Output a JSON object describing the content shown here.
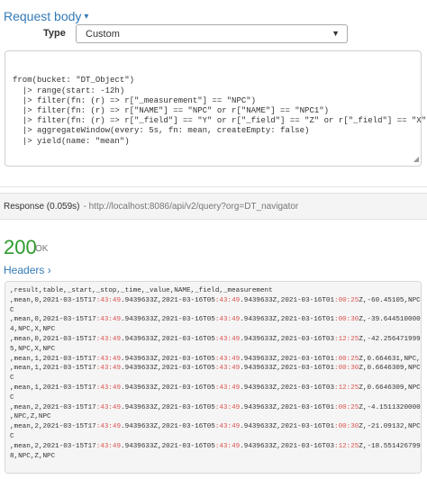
{
  "request": {
    "title": "Request body",
    "type_label": "Type",
    "type_value": "Custom",
    "query_lines": [
      "from(bucket: \"DT_Object\")",
      "  |> range(start: -12h)",
      "  |> filter(fn: (r) => r[\"_measurement\"] == \"NPC\")",
      "  |> filter(fn: (r) => r[\"NAME\"] == \"NPC\" or r[\"NAME\"] == \"NPC1\")",
      "  |> filter(fn: (r) => r[\"_field\"] == \"Y\" or r[\"_field\"] == \"Z\" or r[\"_field\"] == \"X\")",
      "  |> aggregateWindow(every: 5s, fn: mean, createEmpty: false)",
      "  |> yield(name: \"mean\")"
    ]
  },
  "response": {
    "label": "Response (0.059s)",
    "url": "- http://localhost:8086/api/v2/query?org=DT_navigator",
    "status_code": "200",
    "status_text": "OK",
    "headers_link": "Headers ›"
  },
  "csv_lines": [
    ",result,table,_start,_stop,_time,_value,NAME,_field,_measurement",
    ",mean,0,2021-03-15T17:43:49.9439633Z,2021-03-16T05:43:49.9439633Z,2021-03-16T01:00:25Z,-60.45105,NPC,X,NPC",
    "C",
    ",mean,0,2021-03-15T17:43:49.9439633Z,2021-03-16T05:43:49.9439633Z,2021-03-16T01:00:30Z,-39.6445100000000",
    "4,NPC,X,NPC",
    ",mean,0,2021-03-15T17:43:49.9439633Z,2021-03-16T05:43:49.9439633Z,2021-03-16T03:12:25Z,-42.2564719999999",
    "5,NPC,X,NPC",
    ",mean,1,2021-03-15T17:43:49.9439633Z,2021-03-16T05:43:49.9439633Z,2021-03-16T01:00:25Z,0.664631,NPC,Y,NPC",
    ",mean,1,2021-03-15T17:43:49.9439633Z,2021-03-16T05:43:49.9439633Z,2021-03-16T01:00:30Z,0.6646309,NPC,Y,NP",
    "C",
    ",mean,1,2021-03-15T17:43:49.9439633Z,2021-03-16T05:43:49.9439633Z,2021-03-16T03:12:25Z,0.6646309,NPC,Y,NP",
    "C",
    ",mean,2,2021-03-15T17:43:49.9439633Z,2021-03-16T05:43:49.9439633Z,2021-03-16T01:00:25Z,-4.151132000000006",
    ",NPC,Z,NPC",
    ",mean,2,2021-03-15T17:43:49.9439633Z,2021-03-16T05:43:49.9439633Z,2021-03-16T01:00:30Z,-21.09132,NPC,Z,NP",
    "C",
    ",mean,2,2021-03-15T17:43:49.9439633Z,2021-03-16T05:43:49.9439633Z,2021-03-16T03:12:25Z,-18.5514267999999",
    "8,NPC,Z,NPC"
  ],
  "colors": {
    "link": "#337ab7",
    "success": "#2e9b2e",
    "time_highlight": "#d9534f"
  }
}
